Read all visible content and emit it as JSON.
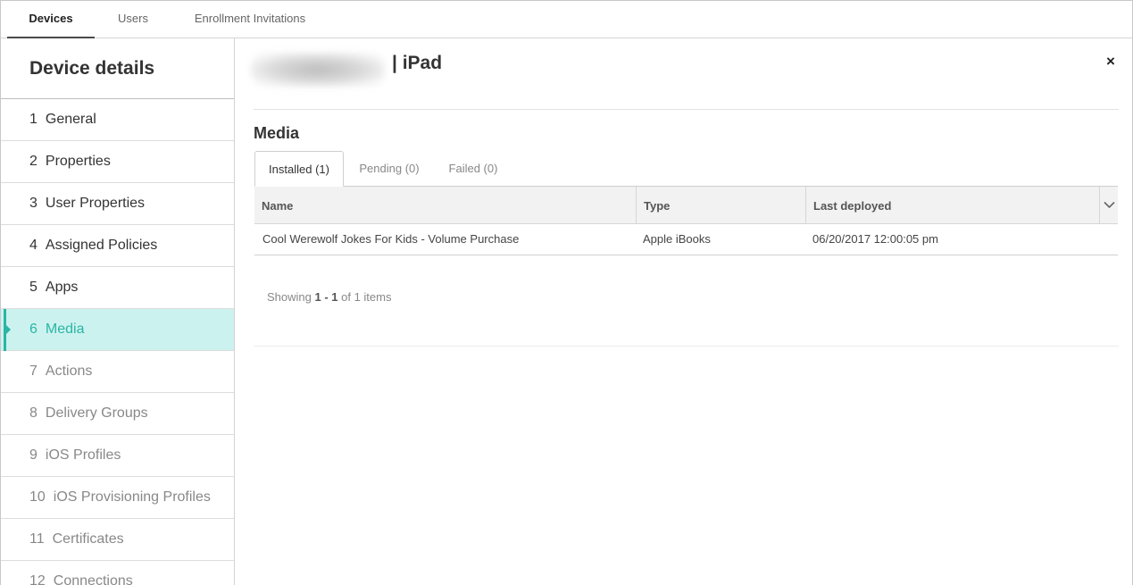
{
  "top_tabs": [
    {
      "label": "Devices"
    },
    {
      "label": "Users"
    },
    {
      "label": "Enrollment Invitations"
    }
  ],
  "sidebar": {
    "title": "Device details",
    "items": [
      {
        "num": "1",
        "label": "General"
      },
      {
        "num": "2",
        "label": "Properties"
      },
      {
        "num": "3",
        "label": "User Properties"
      },
      {
        "num": "4",
        "label": "Assigned Policies"
      },
      {
        "num": "5",
        "label": "Apps"
      },
      {
        "num": "6",
        "label": "Media"
      },
      {
        "num": "7",
        "label": "Actions"
      },
      {
        "num": "8",
        "label": "Delivery Groups"
      },
      {
        "num": "9",
        "label": "iOS Profiles"
      },
      {
        "num": "10",
        "label": "iOS Provisioning Profiles"
      },
      {
        "num": "11",
        "label": "Certificates"
      },
      {
        "num": "12",
        "label": "Connections"
      }
    ]
  },
  "header": {
    "device_title": "| iPad",
    "close_label": "×"
  },
  "media": {
    "title": "Media",
    "tabs": [
      {
        "label": "Installed (1)"
      },
      {
        "label": "Pending (0)"
      },
      {
        "label": "Failed (0)"
      }
    ],
    "columns": [
      "Name",
      "Type",
      "Last deployed"
    ],
    "rows": [
      {
        "name": "Cool Werewolf Jokes For Kids - Volume Purchase",
        "type": "Apple iBooks",
        "last_deployed": "06/20/2017 12:00:05 pm"
      }
    ],
    "showing": {
      "prefix": "Showing ",
      "range": "1 - 1",
      "suffix": " of 1 items"
    }
  },
  "colors": {
    "accent": "#2ab5a4",
    "active_bg": "#ccf2ef"
  }
}
